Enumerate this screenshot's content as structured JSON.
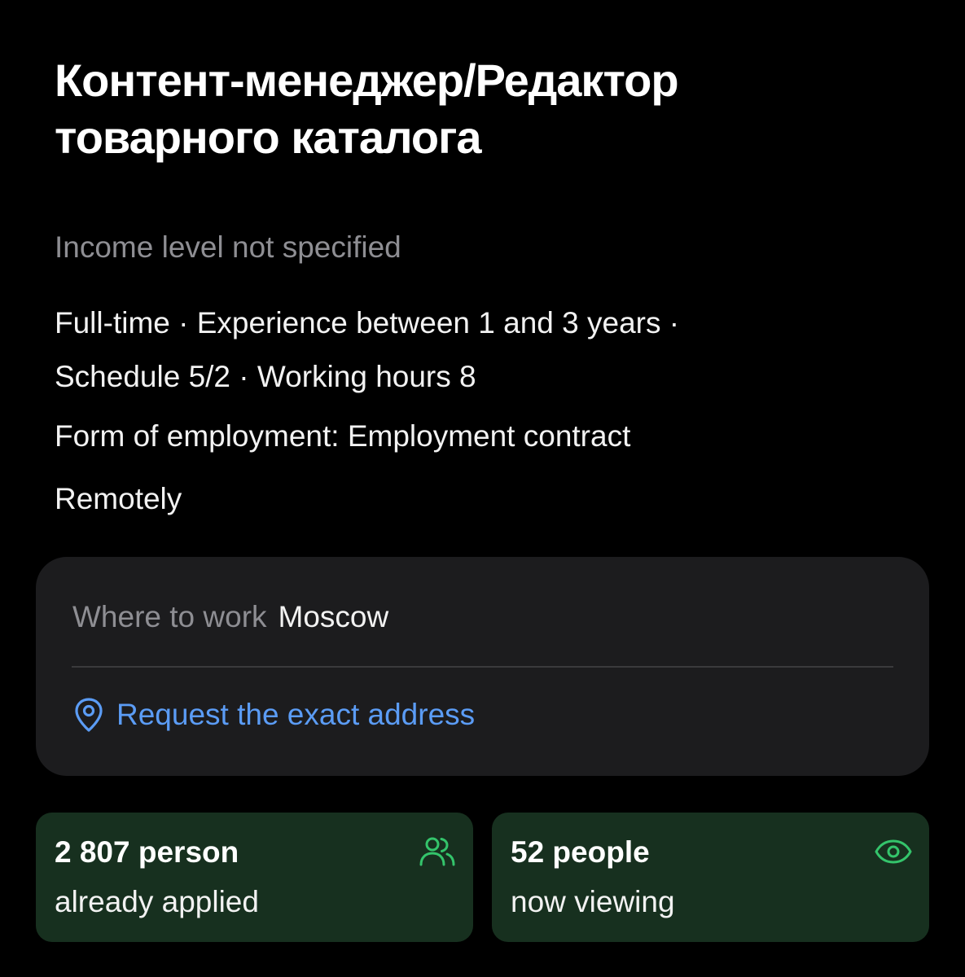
{
  "vacancy": {
    "title_lines": [
      "Контент-менеджер/Редактор",
      "товарного каталога"
    ],
    "income": "Income level not specified",
    "details_lines": [
      "Full-time · Experience between 1 and 3 years ·",
      "Schedule 5/2 · Working hours 8"
    ],
    "employment_form": "Form of employment: Employment contract",
    "work_format": "Remotely"
  },
  "location": {
    "label": "Where to work",
    "city": "Moscow",
    "address_link": "Request the exact address",
    "icon": "location-pin-icon"
  },
  "stats": {
    "applied": {
      "value": "2 807 person",
      "caption": "already applied",
      "icon": "people-icon"
    },
    "viewing": {
      "value": "52 people",
      "caption": "now viewing",
      "icon": "eye-icon"
    }
  },
  "colors": {
    "background": "#000000",
    "card": "#1c1c1e",
    "stat_card": "#17301f",
    "accent_link": "#5b9cf5",
    "accent_green": "#34c46b",
    "muted_text": "#8e8e93"
  }
}
